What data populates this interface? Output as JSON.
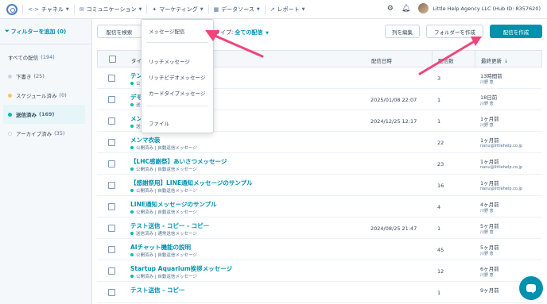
{
  "nav": {
    "items": [
      {
        "icon": "<·>",
        "label": "チャネル"
      },
      {
        "icon": "✉",
        "label": "コミュニケーション"
      },
      {
        "icon": "✦",
        "label": "マーケティング"
      },
      {
        "icon": "▦",
        "label": "データソース"
      },
      {
        "icon": "↗",
        "label": "レポート"
      }
    ],
    "account": "Little Help Agency LLC (Hub ID: 8357620)"
  },
  "sidebar": {
    "add_filter": "フィルターを追加 (0)",
    "items": [
      {
        "label": "すべての配信",
        "count": "(194)",
        "dot": ""
      },
      {
        "label": "下書き",
        "count": "(25)",
        "dot": "#cbd6e2"
      },
      {
        "label": "スケジュール済み",
        "count": "(0)",
        "dot": "#f5c26b"
      },
      {
        "label": "送信済み",
        "count": "(169)",
        "dot": "#00bda5"
      },
      {
        "label": "アーカイブ済み",
        "count": "(35)",
        "dot": "#fff"
      }
    ]
  },
  "toolbar": {
    "search": "配信を検索",
    "type_label": "タイプ:",
    "type_value": "全ての配信",
    "edit_columns": "列を編集",
    "create_folder": "フォルダーを作成",
    "create_delivery": "配信を作成"
  },
  "table": {
    "headers": {
      "name": "タイ",
      "date": "配信日時",
      "count": "配信数",
      "updated": "最終更新"
    },
    "rows": [
      {
        "name": "テン",
        "sub": "公開",
        "date": "",
        "count": "3",
        "updated": "13時間前",
        "by": "川野 恵"
      },
      {
        "name": "デモ",
        "sub": "送信",
        "date": "2025/01/08 22:07",
        "count": "1",
        "updated": "18日前",
        "by": "川野 恵"
      },
      {
        "name": "メン",
        "sub": "送信",
        "date": "2024/12/25 12:17",
        "count": "1",
        "updated": "1ヶ月前",
        "by": "川野 恵"
      },
      {
        "name": "メンマ衣装",
        "sub": "公開済み | 自動返信メッセージ",
        "date": "",
        "count": "22",
        "updated": "1ヶ月前",
        "by": "nanu@littlehelp.co.jp"
      },
      {
        "name": "【LHC感謝祭】あいさつメッセージ",
        "sub": "公開済み | 自動返信メッセージ",
        "date": "",
        "count": "23",
        "updated": "1ヶ月前",
        "by": "nanu@littlehelp.co.jp"
      },
      {
        "name": "【感謝祭用】LINE通知メッセージのサンプル",
        "sub": "公開済み | 自動返信メッセージ",
        "date": "",
        "count": "16",
        "updated": "1ヶ月前",
        "by": "nanu@littlehelp.co.jp"
      },
      {
        "name": "LINE通知メッセージのサンプル",
        "sub": "公開済み | 自動返信メッセージ",
        "date": "",
        "count": "4",
        "updated": "4ヶ月前",
        "by": "川野 恵"
      },
      {
        "name": "テスト送信 - コピー - コピー",
        "sub": "送信済み | 通常送信メッセージ",
        "date": "2024/08/25 21:47",
        "count": "1",
        "updated": "5ヶ月前",
        "by": "川野 恵"
      },
      {
        "name": "AIチャット機能の説明",
        "sub": "公開済み | 自動返信メッセージ",
        "date": "",
        "count": "45",
        "updated": "5ヶ月前",
        "by": "川野 恵"
      },
      {
        "name": "Startup Aquarium挨拶メッセージ",
        "sub": "公開済み | 自動返信メッセージ",
        "date": "",
        "count": "12",
        "updated": "6ヶ月前",
        "by": "川野 恵"
      },
      {
        "name": "テスト送信 - コピー",
        "sub": "",
        "date": "",
        "count": "1",
        "updated": "9ヶ月前",
        "by": ""
      }
    ]
  },
  "dropdown": {
    "items": [
      "メッセージ配信",
      "リッチメッセージ",
      "リッチビデオメッセージ",
      "カードタイプメッセージ",
      "ファイル"
    ]
  },
  "colors": {
    "accent": "#0091ae",
    "arrow": "#f0457a"
  }
}
